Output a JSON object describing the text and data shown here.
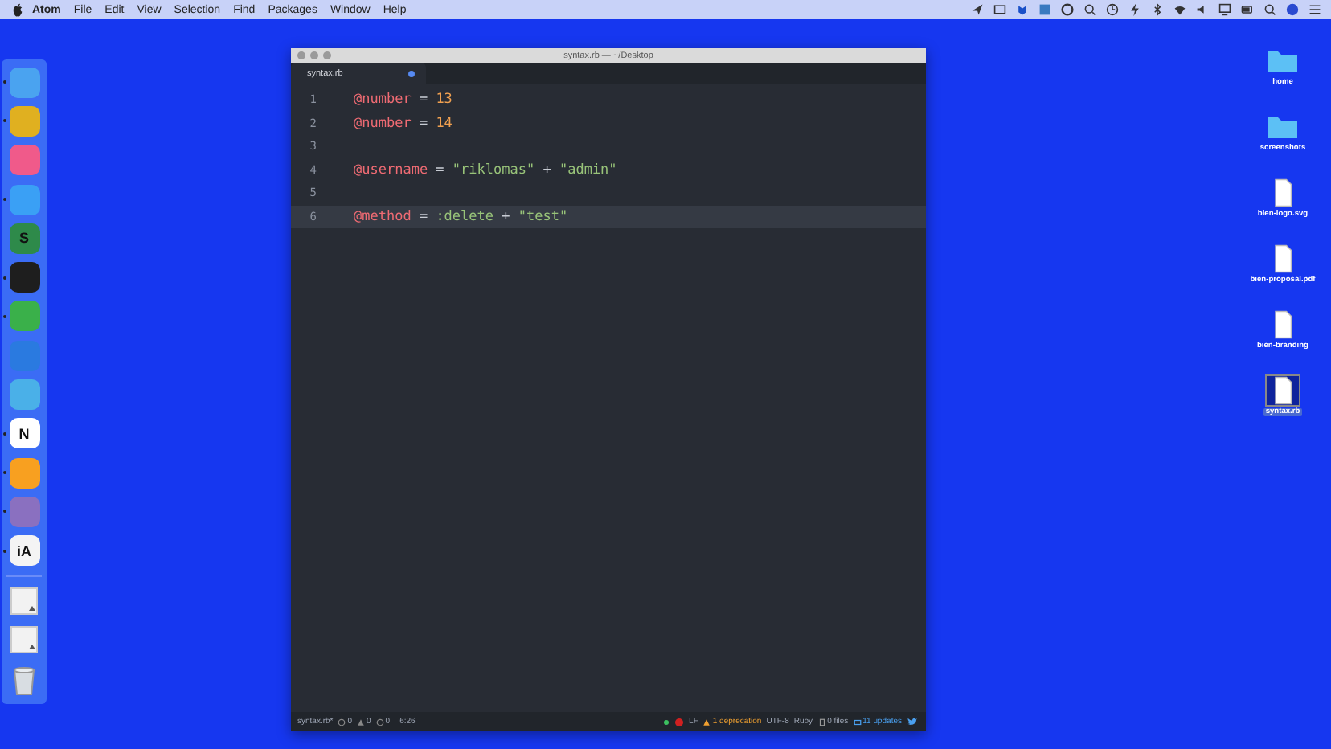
{
  "menu_bar": {
    "app": "Atom",
    "items": [
      "File",
      "Edit",
      "View",
      "Selection",
      "Find",
      "Packages",
      "Window",
      "Help"
    ]
  },
  "dock": {
    "apps": [
      {
        "color": "#4aa3f0",
        "running": true
      },
      {
        "color": "#e0b020",
        "running": true
      },
      {
        "color": "#f05a8a",
        "running": false
      },
      {
        "color": "#3aa0f5",
        "running": true
      },
      {
        "color": "#2e8a4a",
        "running": false,
        "glyph": "S"
      },
      {
        "color": "#1e1e1e",
        "running": true
      },
      {
        "color": "#3ab04a",
        "running": true
      },
      {
        "color": "#2a7ae0",
        "running": false
      },
      {
        "color": "#4ab0e8",
        "running": false
      },
      {
        "color": "#ffffff",
        "running": true,
        "glyph": "N"
      },
      {
        "color": "#f8a020",
        "running": true
      },
      {
        "color": "#8a70c0",
        "running": true
      },
      {
        "color": "#f4f4f4",
        "running": true,
        "glyph": "iA"
      }
    ]
  },
  "window": {
    "title": "syntax.rb — ~/Desktop",
    "tab": {
      "label": "syntax.rb",
      "modified": true
    },
    "lines": [
      {
        "number": "1",
        "current": false,
        "tokens": [
          {
            "kind": "ivar",
            "text": "@number"
          },
          {
            "kind": "op",
            "text": " = "
          },
          {
            "kind": "num",
            "text": "13"
          }
        ]
      },
      {
        "number": "2",
        "current": false,
        "tokens": [
          {
            "kind": "ivar",
            "text": "@number"
          },
          {
            "kind": "op",
            "text": " = "
          },
          {
            "kind": "num",
            "text": "14"
          }
        ]
      },
      {
        "number": "3",
        "current": false
      },
      {
        "number": "4",
        "current": false,
        "tokens": [
          {
            "kind": "ivar",
            "text": "@username"
          },
          {
            "kind": "op",
            "text": " = "
          },
          {
            "kind": "str",
            "text": "\"riklomas\""
          },
          {
            "kind": "op",
            "text": " + "
          },
          {
            "kind": "str",
            "text": "\"admin\""
          }
        ]
      },
      {
        "number": "5",
        "current": false
      },
      {
        "number": "6",
        "current": true,
        "tokens": [
          {
            "kind": "ivar",
            "text": "@method"
          },
          {
            "kind": "op",
            "text": " = "
          },
          {
            "kind": "sym",
            "text": ":delete"
          },
          {
            "kind": "op",
            "text": " + "
          },
          {
            "kind": "str",
            "text": "\"test\""
          }
        ]
      }
    ],
    "status_bar": {
      "file": "syntax.rb*",
      "errors": "0",
      "warnings": "0",
      "infos": "0",
      "cursor": "6:26",
      "line_ending": "LF",
      "deprecations": "1 deprecation",
      "encoding": "UTF-8",
      "grammar": "Ruby",
      "files": "0 files",
      "updates": "11 updates"
    }
  },
  "desktop": [
    {
      "kind": "folder",
      "label": "home",
      "selected": false
    },
    {
      "kind": "folder",
      "label": "screenshots",
      "selected": false
    },
    {
      "kind": "file",
      "label": "bien-logo.svg",
      "selected": false
    },
    {
      "kind": "file",
      "label": "bien-proposal.pdf",
      "selected": false
    },
    {
      "kind": "file",
      "label": "bien-branding",
      "selected": false
    },
    {
      "kind": "file",
      "label": "syntax.rb",
      "selected": true
    }
  ]
}
